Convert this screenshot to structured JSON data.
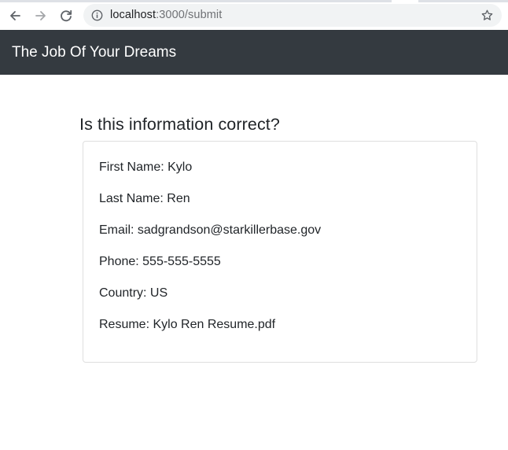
{
  "browser": {
    "url_host": "localhost",
    "url_rest": ":3000/submit",
    "icons": {
      "back": "arrow-left-icon",
      "forward": "arrow-right-icon",
      "reload": "reload-icon",
      "site_info": "info-circle-icon",
      "bookmark": "star-outline-icon"
    }
  },
  "navbar": {
    "brand": "The Job Of Your Dreams",
    "background": "#343a40"
  },
  "main": {
    "title": "Is this information correct?",
    "fields": [
      "First Name: Kylo",
      "Last Name: Ren",
      "Email: sadgrandson@starkillerbase.gov",
      "Phone: 555-555-5555",
      "Country: US",
      "Resume: Kylo Ren Resume.pdf"
    ]
  }
}
